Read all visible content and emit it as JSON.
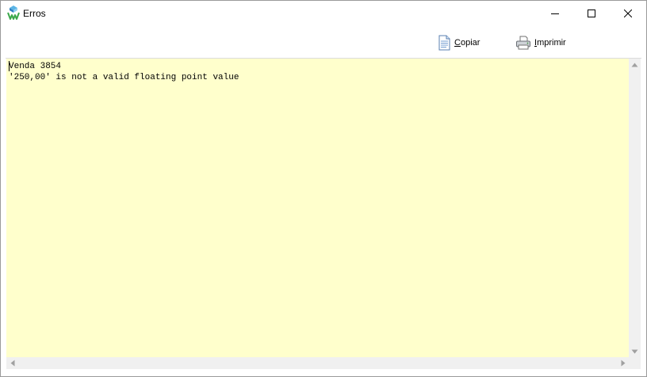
{
  "window": {
    "title": "Erros",
    "app_icon": "app-logo-icon",
    "controls": [
      "minimize-icon",
      "maximize-icon",
      "close-icon"
    ]
  },
  "toolbar": {
    "copy": {
      "accel": "C",
      "rest": "opiar",
      "icon": "document-copy-icon"
    },
    "print": {
      "accel": "I",
      "rest": "mprimir",
      "icon": "printer-icon"
    }
  },
  "memo": {
    "lines": [
      "Venda 3854",
      "'250,00' is not a valid floating point value"
    ],
    "background": "#ffffcc"
  }
}
